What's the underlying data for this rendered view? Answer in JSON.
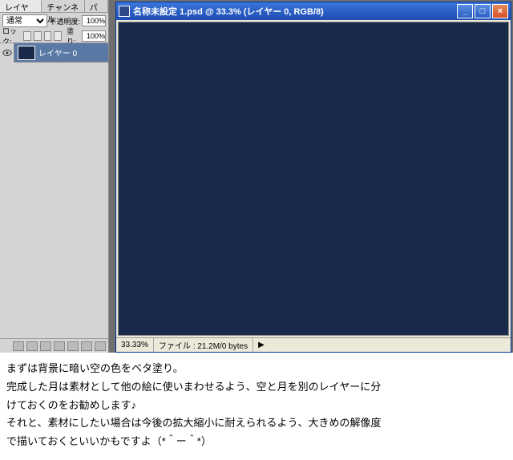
{
  "panel": {
    "tabs": [
      "レイヤー ×",
      "チャンネル",
      "パス"
    ],
    "blend_mode": "通常",
    "opacity_label": "不透明度:",
    "opacity_value": "100%",
    "lock_label": "ロック:",
    "fill_label": "塗り:",
    "fill_value": "100%",
    "layer": {
      "name": "レイヤー 0"
    }
  },
  "doc": {
    "title": "名称未設定 1.psd @ 33.3% (レイヤー 0, RGB/8)",
    "status_zoom": "33.33%",
    "status_file": "ファイル : 21.2M/0 bytes"
  },
  "caption": {
    "l1": "まずは背景に暗い空の色をベタ塗り。",
    "l2": "完成した月は素材として他の絵に使いまわせるよう、空と月を別のレイヤーに分",
    "l3": "けておくのをお勧めします♪",
    "l4": "それと、素材にしたい場合は今後の拡大縮小に耐えられるよう、大きめの解像度",
    "l5": "で描いておくといいかもですよ（*＾ー＾*）"
  }
}
